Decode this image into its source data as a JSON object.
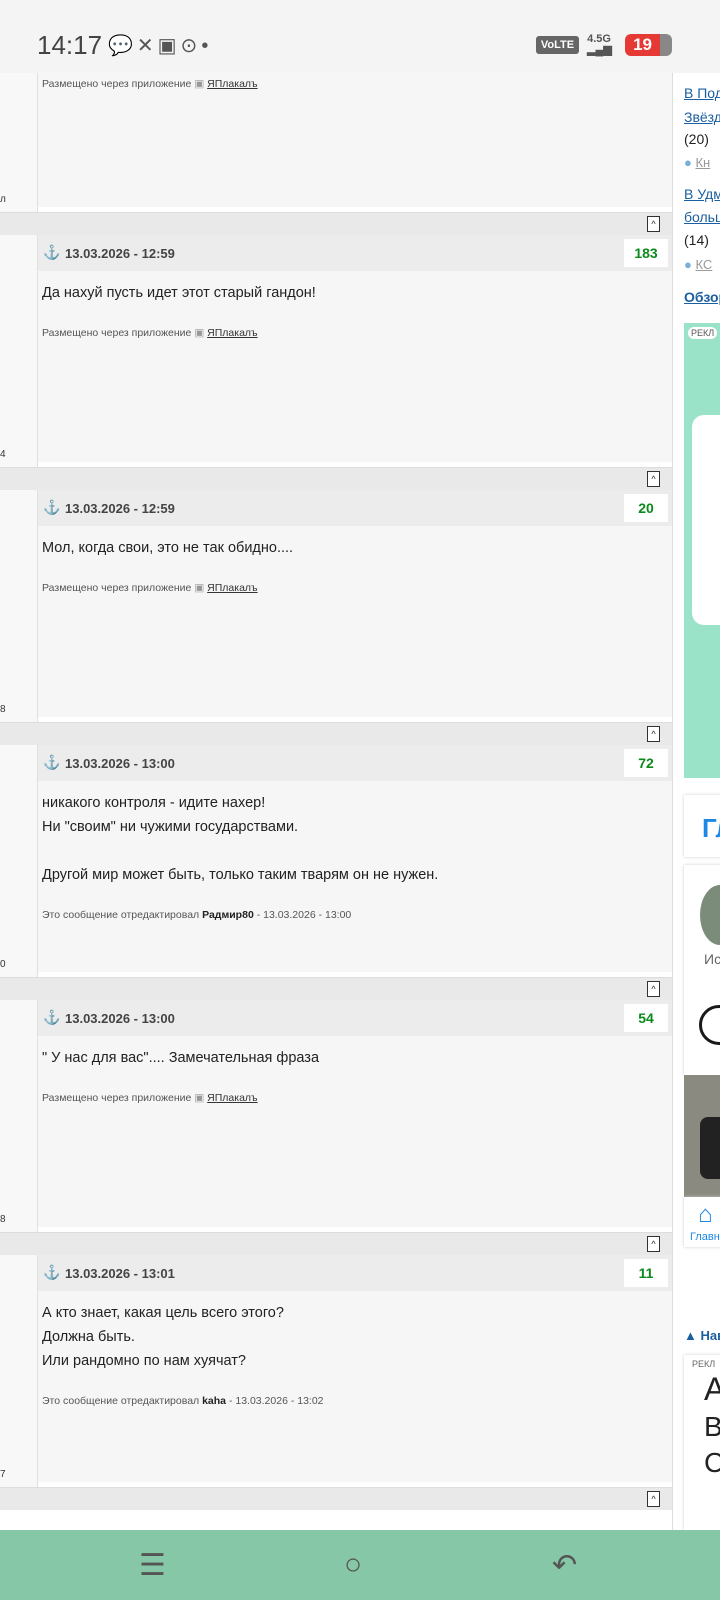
{
  "status_bar": {
    "time": "14:17",
    "network": "VoLTE",
    "signal": "4.5G",
    "battery": "19"
  },
  "posts": [
    {
      "id": "p0",
      "date": "",
      "score": "",
      "text": "",
      "user_num": "",
      "footer_type": "app",
      "footer_prefix": "Размещено через приложение",
      "footer_app": "ЯПлакалъ"
    },
    {
      "id": "p1",
      "date": "13.03.2026 - 12:59",
      "score": "183",
      "text": "Да нахуй пусть идет этот старый гандон!",
      "user_num": "4",
      "footer_prefix": "Размещено через приложение",
      "footer_app": "ЯПлакалъ"
    },
    {
      "id": "p2",
      "date": "13.03.2026 - 12:59",
      "score": "20",
      "text": "Мол, когда свои, это не так обидно....",
      "user_num": "8",
      "footer_prefix": "Размещено через приложение",
      "footer_app": "ЯПлакалъ"
    },
    {
      "id": "p3",
      "date": "13.03.2026 - 13:00",
      "score": "72",
      "text": "никакого контроля - идите нахер!\nНи \"своим\" ни чужими государствами.\n\nДругой мир может быть, только таким тварям он не нужен.",
      "user_num": "0",
      "footer_prefix": "Это сообщение отредактировал",
      "footer_user": "Радмир80",
      "footer_date": " - 13.03.2026 - 13:00"
    },
    {
      "id": "p4",
      "date": "13.03.2026 - 13:00",
      "score": "54",
      "text": "\" У нас для вас\".... Замечательная фраза",
      "user_num": "8",
      "footer_prefix": "Размещено через приложение",
      "footer_app": "ЯПлакалъ"
    },
    {
      "id": "p5",
      "date": "13.03.2026 - 13:01",
      "score": "11",
      "text": "А кто знает, какая цель всего этого?\nДолжна быть.\nИли рандомно по нам хуячат?",
      "user_num": "7",
      "footer_prefix": "Это сообщение отредактировал",
      "footer_user": "kaha",
      "footer_date": " - 13.03.2026 - 13:02"
    }
  ],
  "sidebar": {
    "item1_line1": "В Под",
    "item1_line2": "Звёзд",
    "item1_count": "(20)",
    "item1_user": "Кн",
    "item2_line1": "В Удм",
    "item2_line2": "больш",
    "item2_count": "(14)",
    "item2_user": "КС",
    "review_link": "Обзор",
    "ad_label": "РЕКЛ",
    "block_title": "Гл",
    "block_user": "Ис",
    "home_label": "Главн",
    "nav_section": "▲ Нав",
    "ad2_label": "РЕКЛ",
    "ad2_letters": [
      "А",
      "В",
      "С"
    ]
  },
  "nav": {
    "menu_icon": "☰",
    "home_icon": "○",
    "back_icon": "↶"
  }
}
